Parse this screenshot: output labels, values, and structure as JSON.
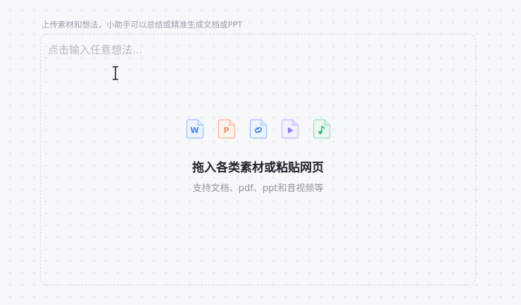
{
  "composer": {
    "hint": "上传素材和想法，小助手可以总结或精准生成文档或PPT",
    "input_placeholder": "点击输入任意想法..."
  },
  "dropzone": {
    "title": "拖入各类素材或粘贴网页",
    "subtitle": "支持文档、pdf、ppt和音视频等",
    "icons": [
      {
        "name": "word-doc-icon",
        "glyph": "W",
        "color": "#3b82f6"
      },
      {
        "name": "ppt-icon",
        "glyph": "P",
        "color": "#f08a5d"
      },
      {
        "name": "link-icon",
        "color": "#3b82f6"
      },
      {
        "name": "video-icon",
        "color": "#8b7cf6"
      },
      {
        "name": "audio-icon",
        "color": "#2fb580"
      }
    ]
  }
}
